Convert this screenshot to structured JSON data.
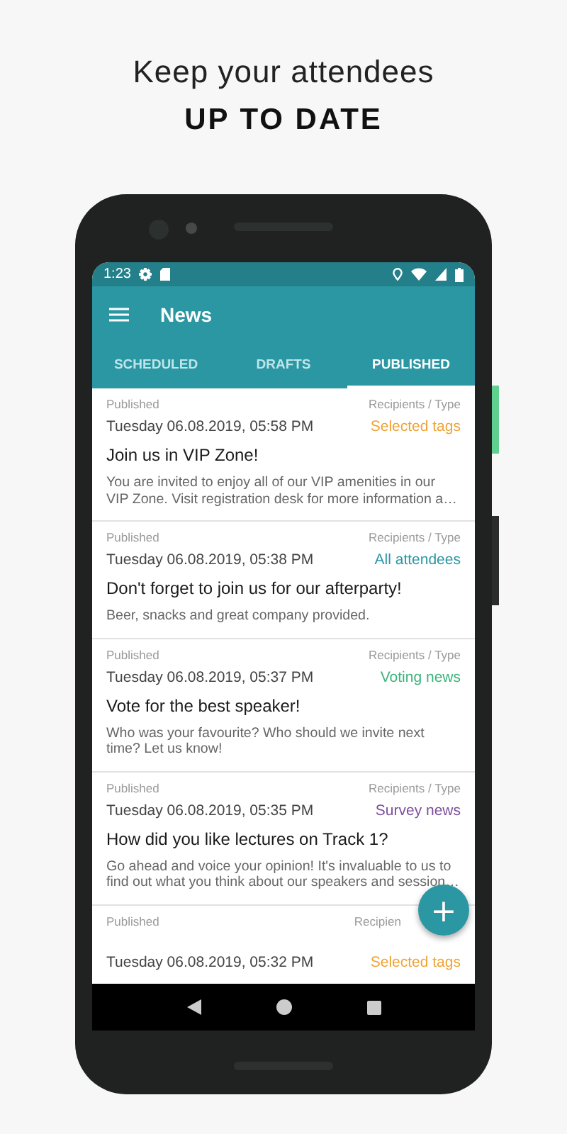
{
  "headline": {
    "line_1": "Keep your attendees",
    "line_2": "UP TO DATE"
  },
  "status_bar": {
    "time": "1:23"
  },
  "app_bar": {
    "title": "News"
  },
  "tabs": [
    {
      "label": "SCHEDULED",
      "selected": false
    },
    {
      "label": "DRAFTS",
      "selected": false
    },
    {
      "label": "PUBLISHED",
      "selected": true
    }
  ],
  "news": [
    {
      "status_label": "Published",
      "recipients_label": "Recipients / Type",
      "date": "Tuesday 06.08.2019, 05:58 PM",
      "type": "Selected tags",
      "color": "#f0a336",
      "title": "Join us in VIP Zone!",
      "body": "You are invited to enjoy all of our VIP amenities in our VIP Zone. Visit registration desk for more information a…"
    },
    {
      "status_label": "Published",
      "recipients_label": "Recipients / Type",
      "date": "Tuesday 06.08.2019, 05:38 PM",
      "type": "All attendees",
      "color": "#2a97a3",
      "title": "Don't forget to join us for our afterparty!",
      "body": "Beer, snacks and great company provided."
    },
    {
      "status_label": "Published",
      "recipients_label": "Recipients / Type",
      "date": "Tuesday 06.08.2019, 05:37 PM",
      "type": "Voting news",
      "color": "#3cb37a",
      "title": "Vote for the best speaker!",
      "body": "Who was your favourite? Who should we invite next time? Let us know!"
    },
    {
      "status_label": "Published",
      "recipients_label": "Recipients / Type",
      "date": "Tuesday 06.08.2019, 05:35 PM",
      "type": "Survey news",
      "color": "#7b4f9c",
      "title": "How did you like lectures on Track 1?",
      "body": "Go ahead and voice your opinion! It's invaluable to us to find out what you think about our speakers and session…"
    },
    {
      "status_label": "Published",
      "recipients_label": "Recipien",
      "date": "Tuesday 06.08.2019, 05:32 PM",
      "type": "Selected tags",
      "color": "#f0a336"
    }
  ],
  "fab": {
    "label": "+"
  }
}
